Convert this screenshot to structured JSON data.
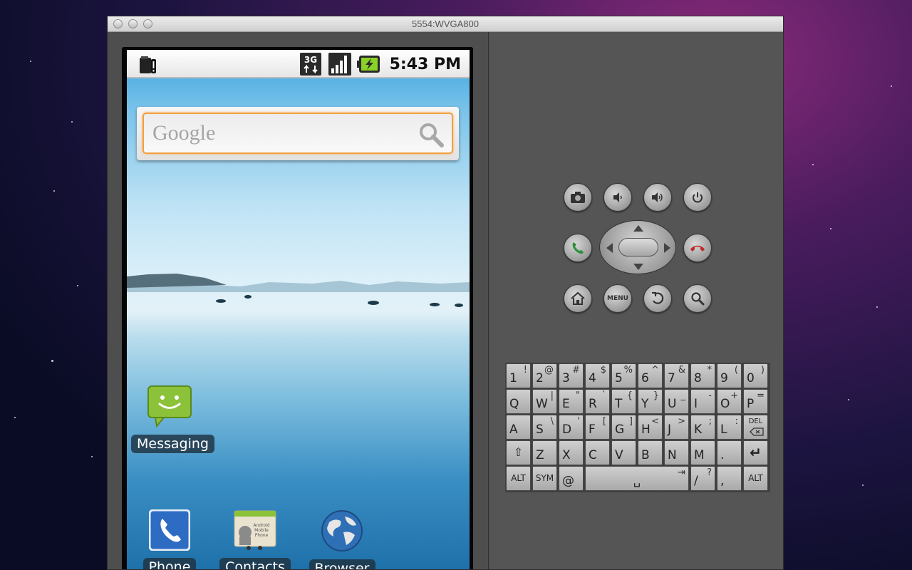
{
  "window": {
    "title": "5554:WVGA800"
  },
  "statusbar": {
    "time": "5:43 PM",
    "network": "3G"
  },
  "search_widget": {
    "logo": "Google",
    "icon": "magnifier-icon"
  },
  "home_apps": [
    {
      "label": "Messaging"
    },
    {
      "label": "Phone"
    },
    {
      "label": "Contacts",
      "icon_caption": [
        "Android",
        "Mobile",
        "Phone"
      ]
    },
    {
      "label": "Browser"
    }
  ],
  "controls": {
    "menu_label": "MENU",
    "buttons": [
      "camera-icon",
      "volume-down-icon",
      "volume-up-icon",
      "power-icon",
      "call-icon",
      "end-call-icon",
      "home-icon",
      "menu",
      "back-icon",
      "search-icon"
    ]
  },
  "keyboard": {
    "row1": [
      [
        "1",
        "!"
      ],
      [
        "2",
        "@"
      ],
      [
        "3",
        "#"
      ],
      [
        "4",
        "$"
      ],
      [
        "5",
        "%"
      ],
      [
        "6",
        "^"
      ],
      [
        "7",
        "&"
      ],
      [
        "8",
        "*"
      ],
      [
        "9",
        "("
      ],
      [
        "0",
        ")"
      ]
    ],
    "row2": [
      [
        "Q",
        ""
      ],
      [
        "W",
        "|"
      ],
      [
        "E",
        "\""
      ],
      [
        "R",
        "`"
      ],
      [
        "T",
        "{"
      ],
      [
        "Y",
        "}"
      ],
      [
        "U",
        "_"
      ],
      [
        "I",
        "-"
      ],
      [
        "O",
        "+"
      ],
      [
        "P",
        "="
      ]
    ],
    "row3": [
      [
        "A",
        ""
      ],
      [
        "S",
        "\\"
      ],
      [
        "D",
        "'"
      ],
      [
        "F",
        "["
      ],
      [
        "G",
        "]"
      ],
      [
        "H",
        "<"
      ],
      [
        "J",
        ">"
      ],
      [
        "K",
        ";"
      ],
      [
        "L",
        ":"
      ],
      [
        "DEL",
        ""
      ]
    ],
    "row4": [
      [
        "⇧",
        ""
      ],
      [
        "Z",
        ""
      ],
      [
        "X",
        ""
      ],
      [
        "C",
        ""
      ],
      [
        "V",
        ""
      ],
      [
        "B",
        ""
      ],
      [
        "N",
        ""
      ],
      [
        "M",
        ""
      ],
      [
        ".",
        ""
      ],
      [
        "↵",
        ""
      ]
    ],
    "row5": [
      [
        "ALT",
        ""
      ],
      [
        "SYM",
        ""
      ],
      [
        "@",
        ""
      ],
      [
        "␣",
        "⇥"
      ],
      [
        "/",
        "?"
      ],
      [
        ",",
        ""
      ],
      [
        "ALT",
        ""
      ]
    ]
  },
  "colors": {
    "accent": "#f0a040",
    "call": "#2f8f3a",
    "endcall": "#c0282a"
  }
}
